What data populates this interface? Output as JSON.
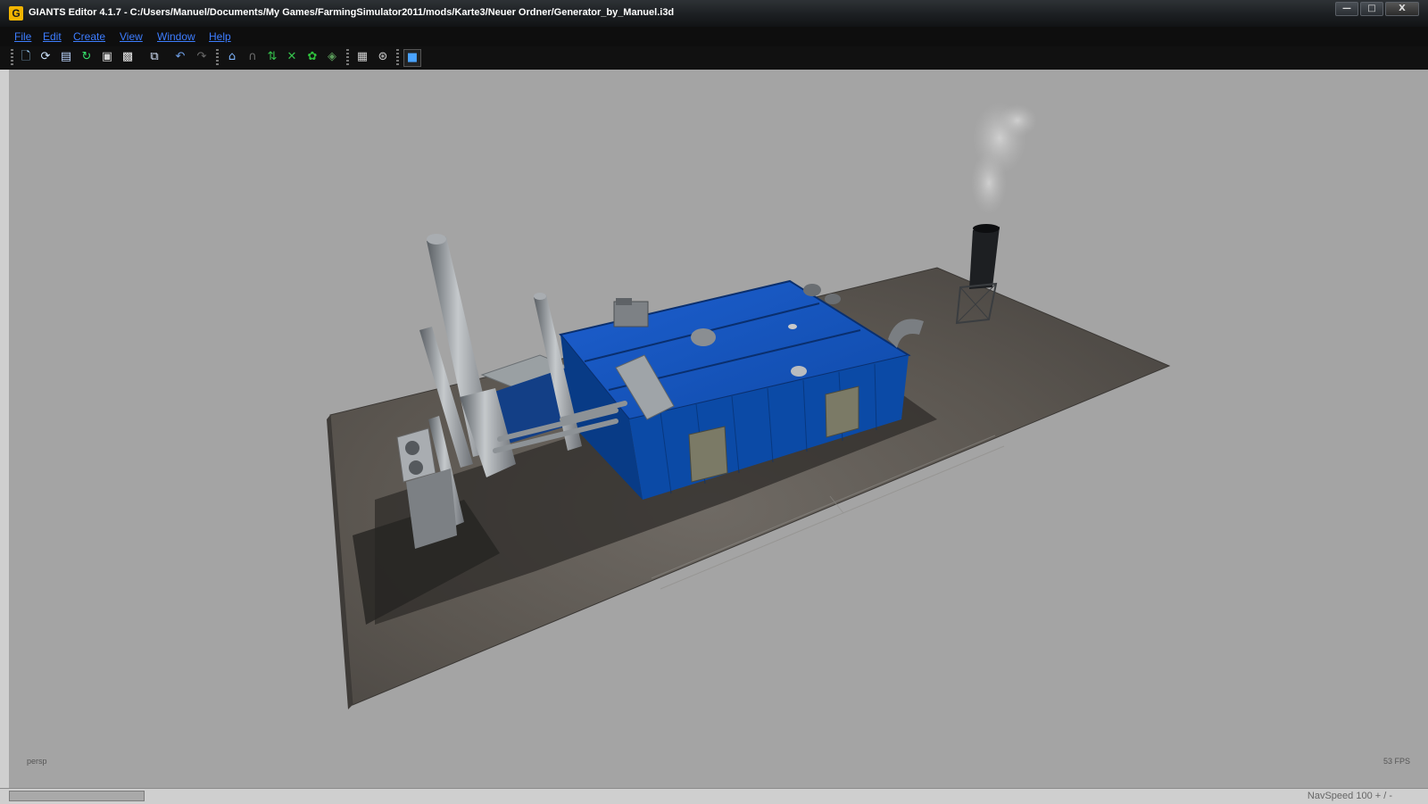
{
  "window": {
    "title": "GIANTS Editor 4.1.7 - C:/Users/Manuel/Documents/My Games/FarmingSimulator2011/mods/Karte3/Neuer Ordner/Generator_by_Manuel.i3d",
    "app_icon_letter": "G",
    "minimize": "—",
    "maximize": "□",
    "close": "X"
  },
  "menu": {
    "items": [
      "File",
      "Edit",
      "Create",
      "View",
      "Window",
      "Help"
    ]
  },
  "toolbar": {
    "icons": [
      "new-file-icon",
      "open-icon",
      "document-icon",
      "refresh-icon",
      "save-icon",
      "save-all-icon",
      "import-icon",
      "undo-icon",
      "redo-icon",
      "home-icon",
      "camera-icon",
      "terrain-raise-icon",
      "terrain-paint-icon",
      "foliage-paint-icon",
      "object-paint-icon",
      "grid-toggle-icon",
      "wireframe-icon",
      "render-icon"
    ]
  },
  "viewport": {
    "camera": "persp",
    "fps": "53 FPS"
  },
  "status": {
    "navspeed": "NavSpeed 100 + / -"
  },
  "colors": {
    "menu_link": "#3d7dff",
    "viewport_bg": "#a4a4a4",
    "container_blue": "#0a4fa8"
  }
}
